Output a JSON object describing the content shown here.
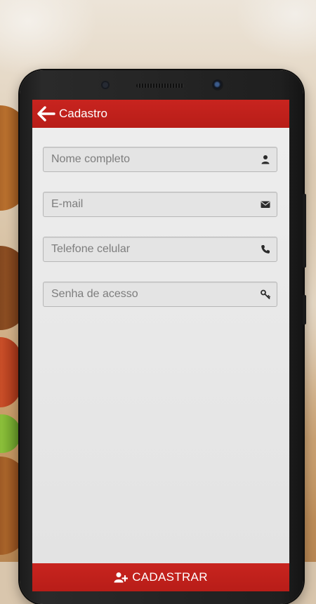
{
  "header": {
    "title": "Cadastro"
  },
  "form": {
    "fields": [
      {
        "placeholder": "Nome completo",
        "value": "",
        "icon": "user-icon"
      },
      {
        "placeholder": "E-mail",
        "value": "",
        "icon": "envelope-icon"
      },
      {
        "placeholder": "Telefone celular",
        "value": "",
        "icon": "phone-icon"
      },
      {
        "placeholder": "Senha de acesso",
        "value": "",
        "icon": "key-icon"
      }
    ]
  },
  "submit": {
    "label": "CADASTRAR",
    "icon": "user-plus-icon"
  },
  "colors": {
    "accent": "#c8241f",
    "background": "#e8e8e8",
    "field_border": "#b7b7b7"
  }
}
